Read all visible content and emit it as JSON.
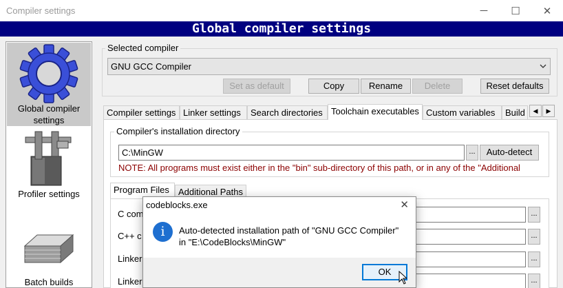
{
  "window": {
    "title": "Compiler settings",
    "minimize_glyph": "─",
    "maximize_glyph": "☐",
    "close_glyph": "✕"
  },
  "banner": "Global compiler settings",
  "sidebar": {
    "items": [
      {
        "label": "Global compiler settings",
        "icon": "gear-icon",
        "active": true
      },
      {
        "label": "Profiler settings",
        "icon": "caliper-icon",
        "active": false
      },
      {
        "label": "Batch builds",
        "icon": "stacked-papers-icon",
        "active": false
      }
    ]
  },
  "selected_compiler": {
    "legend": "Selected compiler",
    "value": "GNU GCC Compiler",
    "buttons": {
      "set_default": "Set as default",
      "copy": "Copy",
      "rename": "Rename",
      "delete": "Delete",
      "reset": "Reset defaults"
    }
  },
  "tabs": [
    {
      "label": "Compiler settings"
    },
    {
      "label": "Linker settings"
    },
    {
      "label": "Search directories"
    },
    {
      "label": "Toolchain executables"
    },
    {
      "label": "Custom variables"
    },
    {
      "label": "Build"
    }
  ],
  "toolchain": {
    "install_legend": "Compiler's installation directory",
    "install_path": "C:\\MinGW",
    "browse_label": "...",
    "autodetect_label": "Auto-detect",
    "note": "NOTE: All programs must exist either in the \"bin\" sub-directory of this path, or in any of the \"Additional",
    "inner_tabs": [
      {
        "label": "Program Files"
      },
      {
        "label": "Additional Paths"
      }
    ],
    "rows": [
      {
        "label": "C com"
      },
      {
        "label": "C++ c"
      },
      {
        "label": "Linker"
      },
      {
        "label": "Linker"
      }
    ]
  },
  "dialog": {
    "title": "codeblocks.exe",
    "close_glyph": "✕",
    "info_glyph": "i",
    "message_line1": "Auto-detected installation path of \"GNU GCC Compiler\"",
    "message_line2": "in \"E:\\CodeBlocks\\MinGW\"",
    "ok_label": "OK"
  },
  "colors": {
    "banner_bg": "#000080",
    "note_text": "#8b0000",
    "info_icon": "#1e6fd0",
    "default_button_border": "#0078d7"
  }
}
